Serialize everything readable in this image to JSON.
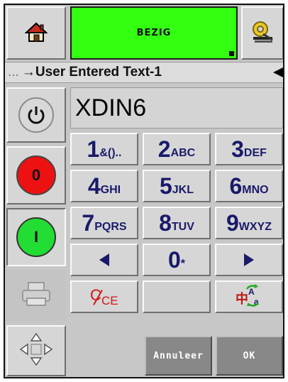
{
  "status": {
    "label": "BEZIG",
    "color": "#33ff11"
  },
  "breadcrumb": {
    "prefix": "...",
    "text": "→User Entered Text-1"
  },
  "display": {
    "value": "XDIN6"
  },
  "keypad": {
    "keys": [
      {
        "big": "1",
        "sub": "&()..",
        "name": "key-1"
      },
      {
        "big": "2",
        "sub": "ABC",
        "name": "key-2"
      },
      {
        "big": "3",
        "sub": "DEF",
        "name": "key-3"
      },
      {
        "big": "4",
        "sub": "GHI",
        "name": "key-4"
      },
      {
        "big": "5",
        "sub": "JKL",
        "name": "key-5"
      },
      {
        "big": "6",
        "sub": "MNO",
        "name": "key-6"
      },
      {
        "big": "7",
        "sub": "PQRS",
        "name": "key-7"
      },
      {
        "big": "8",
        "sub": "TUV",
        "name": "key-8"
      },
      {
        "big": "9",
        "sub": "WXYZ",
        "name": "key-9"
      },
      {
        "big": "0",
        "sub": "*",
        "name": "key-0"
      }
    ],
    "clear_label_c": "C",
    "clear_label_ce": "CE"
  },
  "buttons": {
    "cancel": "Annuleer",
    "ok": "OK"
  },
  "side": {
    "stop_label": "0",
    "start_label": "I"
  },
  "icons": {
    "home": "home-icon",
    "gear": "gear-wrench-icon",
    "power": "power-icon",
    "stop": "red-stop-icon",
    "start": "green-start-icon",
    "print": "printer-icon",
    "nav": "arrows-nav-icon",
    "left": "left-arrow-icon",
    "right": "right-arrow-icon",
    "ime": "input-mode-icon"
  }
}
